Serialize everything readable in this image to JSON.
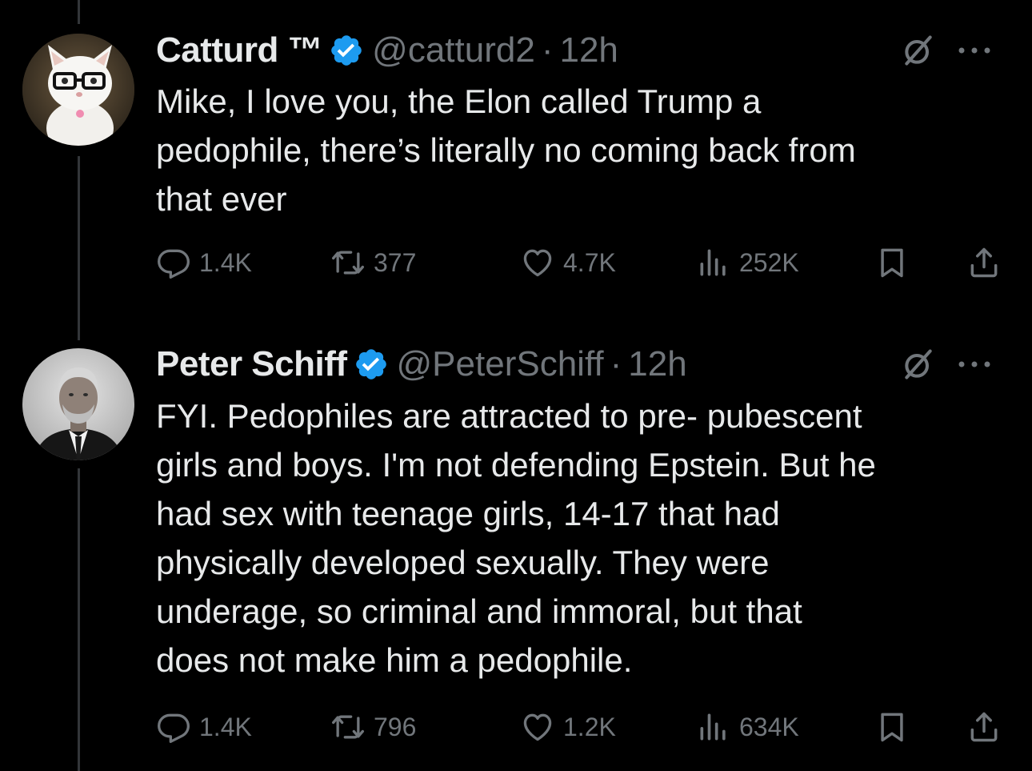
{
  "tweets": [
    {
      "name": "Catturd ™",
      "handle": "@catturd2",
      "separator": "·",
      "time": "12h",
      "text_lines": [
        "Mike, I love you, the Elon called Trump a",
        "pedophile, there’s literally no coming back from",
        "that ever"
      ],
      "avatar_icon": "cat-with-glasses-avatar",
      "stats": {
        "replies": "1.4K",
        "reposts": "377",
        "likes": "4.7K",
        "views": "252K"
      }
    },
    {
      "name": "Peter Schiff",
      "handle": "@PeterSchiff",
      "separator": "·",
      "time": "12h",
      "text_lines": [
        "FYI. Pedophiles are attracted to pre- pubescent",
        "girls and boys.  I'm not defending Epstein. But he",
        "had sex with teenage girls, 14-17 that had",
        "physically developed sexually. They were",
        "underage, so criminal and immoral, but that",
        "does not make him a pedophile."
      ],
      "avatar_icon": "man-portrait-avatar",
      "stats": {
        "replies": "1.4K",
        "reposts": "796",
        "likes": "1.2K",
        "views": "634K"
      }
    }
  ],
  "icons": {
    "verified": "verified-badge-icon",
    "grok": "grok-icon",
    "more": "more-icon",
    "reply": "reply-icon",
    "repost": "repost-icon",
    "like": "heart-icon",
    "views": "views-icon",
    "bookmark": "bookmark-icon",
    "share": "share-icon"
  },
  "colors": {
    "background": "#000000",
    "text": "#e7e9ea",
    "secondary": "#71767b",
    "verified": "#1d9bf0",
    "thread_line": "#333639"
  }
}
